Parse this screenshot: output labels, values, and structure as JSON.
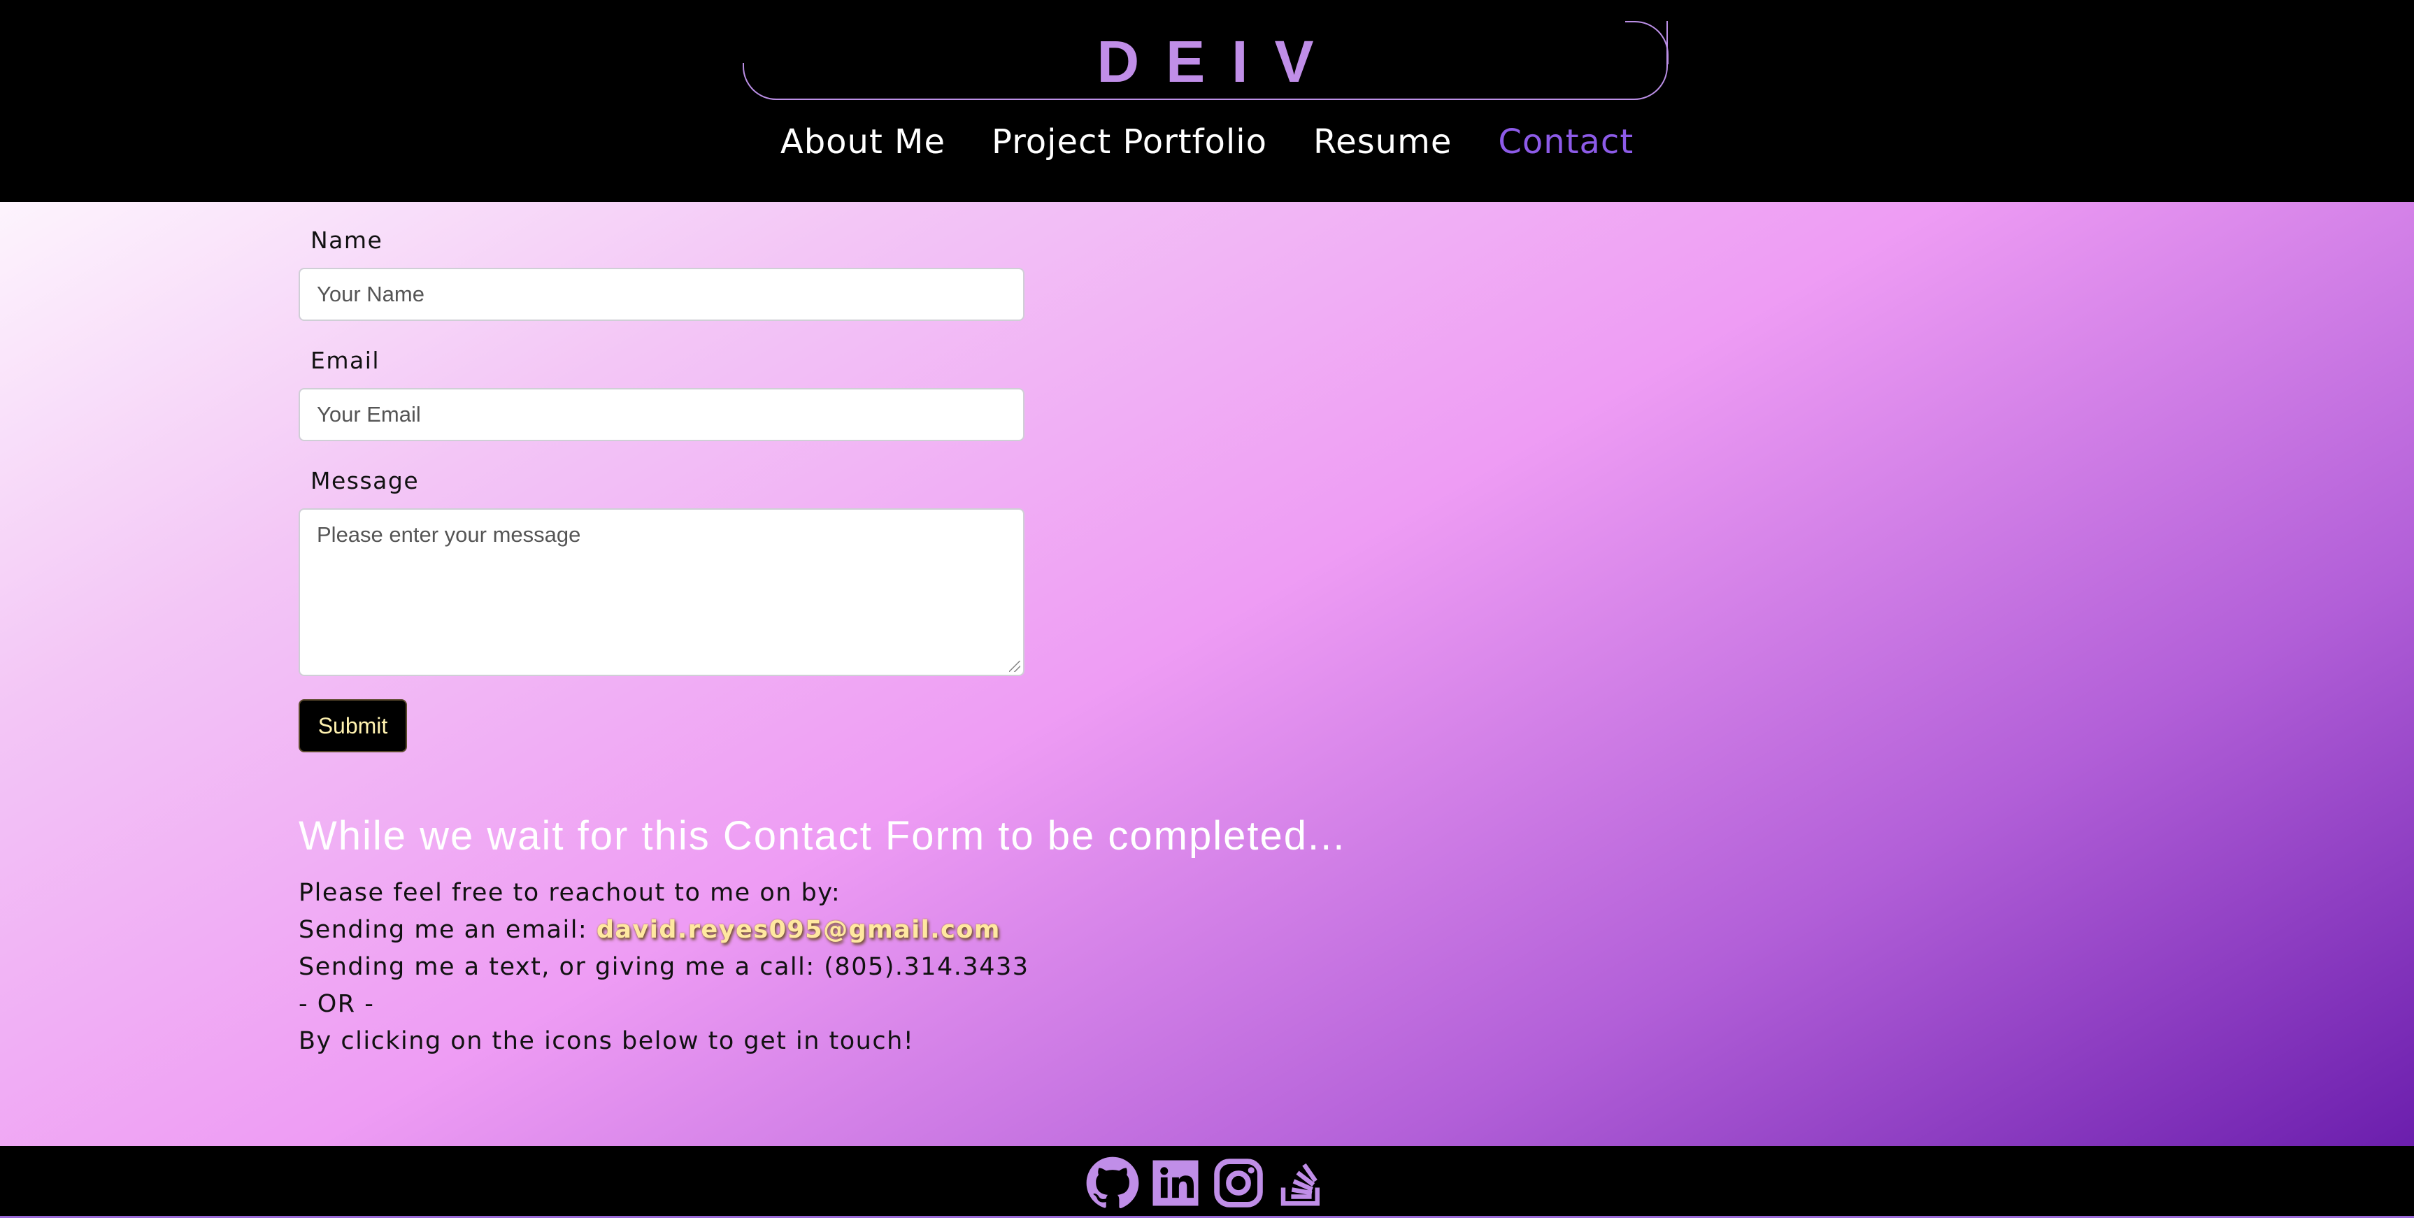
{
  "header": {
    "brand": "DEIV",
    "nav": [
      {
        "label": "About Me"
      },
      {
        "label": "Project Portfolio"
      },
      {
        "label": "Resume"
      },
      {
        "label": "Contact"
      }
    ],
    "active_nav": "Contact"
  },
  "form": {
    "name_label": "Name",
    "name_placeholder": "Your Name",
    "email_label": "Email",
    "email_placeholder": "Your Email",
    "message_label": "Message",
    "message_placeholder": "Please enter your message",
    "submit_label": "Submit"
  },
  "contact_info": {
    "heading": "While we wait for this Contact Form to be completed...",
    "line1": "Please feel free to reachout to me on by:",
    "line2_prefix": "Sending me an email: ",
    "email": "david.reyes095@gmail.com",
    "line3": "Sending me a text, or giving me a call: (805).314.3433",
    "line4": "- OR -",
    "line5": "By clicking on the icons below to get in touch!"
  },
  "footer": {
    "icons": [
      "github-icon",
      "linkedin-icon",
      "instagram-icon",
      "stackoverflow-icon"
    ]
  },
  "colors": {
    "accent": "#c08ee8",
    "nav_active": "#8d5be8",
    "email_highlight": "#ffe8a0"
  }
}
